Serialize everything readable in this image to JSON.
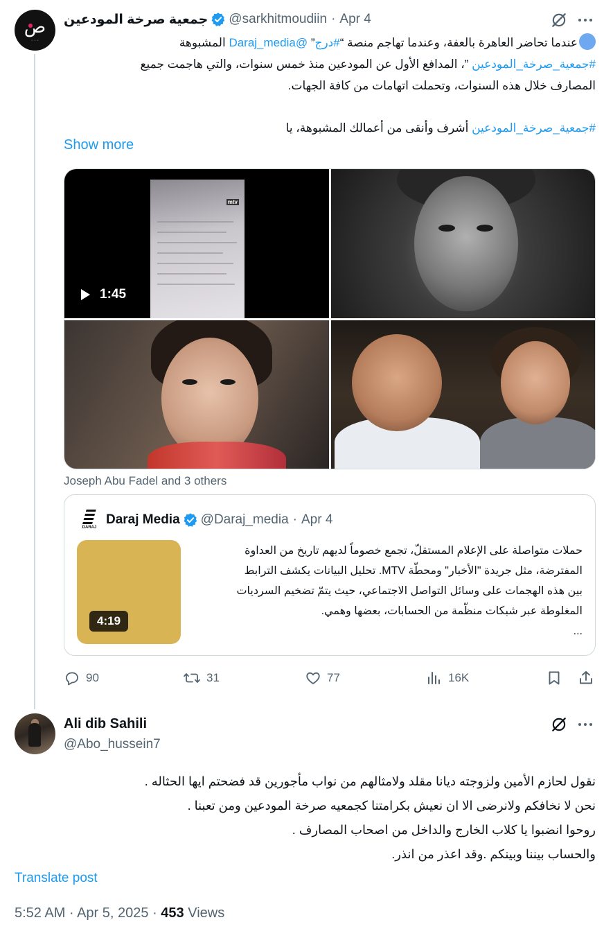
{
  "colors": {
    "link": "#1d9bf0",
    "muted": "#536471",
    "text": "#0f1419",
    "verified": "#1d9bf0"
  },
  "tweet1": {
    "avatar_icon": "sarkhat-logo",
    "author_name": "جمعية صرخة المودعين",
    "handle": "@sarkhitmoudiin",
    "separator": "·",
    "date": "Apr 4",
    "body": {
      "line1_pre": "عندما تحاضر العاهرة بالعفة، وعندما تهاجم منصة “",
      "line1_hashtag": "#درج",
      "line1_mid": "” ",
      "line1_mention": "@Daraj_media",
      "line1_post": " المشبوهة",
      "line2_hashtag": "#جمعية_صرخة_المودعين",
      "line2_post": " ”، المدافع الأول عن المودعين منذ خمس سنوات، والتي هاجمت جميع",
      "line3": "المصارف خلال هذه السنوات، وتحملت اتهامات من كافة الجهات.",
      "line4_hashtag": "#جمعية_صرخة_المودعين",
      "line4_post": " أشرف وأنقى من أعمالك المشبوهة، يا"
    },
    "show_more": "Show more",
    "video_duration": "1:45",
    "video_channel": "mtv",
    "tagged": "Joseph Abu Fadel and 3 others",
    "quote": {
      "logo_text": "DARAJ",
      "author_name": "Daraj Media",
      "handle": "@Daraj_media",
      "separator": "·",
      "date": "Apr 4",
      "duration": "4:19",
      "lines": [
        "حملات متواصلة على الإعلام المستقلّ، تجمع خصوماً لديهم تاريخ من العداوة",
        "المفترضة، مثل جريدة \"الأخبار\" ومحطّة MTV. تحليل البيانات يكشف الترابط",
        "بين هذه الهجمات على وسائل التواصل الاجتماعي، حيث يتمّ تضخيم السرديات",
        "المغلوطة عبر شبكات منظّمة من الحسابات، بعضها وهمي.",
        "..."
      ]
    },
    "actions": {
      "replies": "90",
      "reposts": "31",
      "likes": "77",
      "views": "16K"
    }
  },
  "tweet2": {
    "author_name": "Ali dib Sahili",
    "handle": "@Abo_hussein7",
    "lines": [
      "نقول لحازم الأمين ولزوجته ديانا مقلد ولامثالهم من نواب مأجورين قد فضحتم ايها الحثاله .",
      "نحن لا نخافكم ولانرضى الا ان نعيش بكرامتنا كجمعيه صرخة المودعين ومن تعبنا .",
      "روحوا انضبوا يا كلاب الخارج والداخل من اصحاب المصارف .",
      "والحساب بيننا وبينكم .وقد اعذر من انذر."
    ],
    "translate": "Translate post",
    "time": "5:52 AM",
    "separator": "·",
    "date": "Apr 5, 2025",
    "views_count": "453",
    "views_label": "Views"
  }
}
